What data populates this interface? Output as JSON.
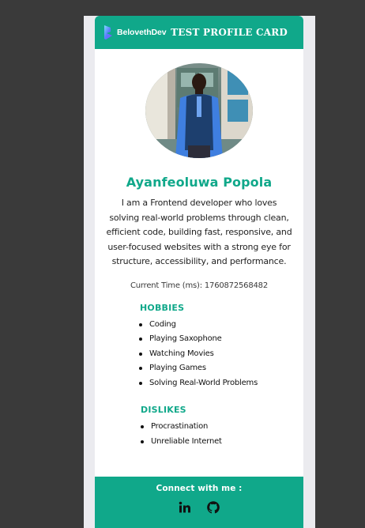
{
  "header": {
    "brand": "BelovethDev",
    "title": "TEST PROFILE CARD"
  },
  "profile": {
    "name": "Ayanfeoluwa Popola",
    "bio": "I am a Frontend developer who loves solving real-world problems through clean, efficient code, building fast, responsive, and user-focused websites with a strong eye for structure, accessibility, and performance.",
    "current_time": "Current Time (ms): 1760872568482"
  },
  "hobbies": {
    "title": "HOBBIES",
    "items": [
      "Coding",
      "Playing Saxophone",
      "Watching Movies",
      "Playing Games",
      "Solving Real-World Problems"
    ]
  },
  "dislikes": {
    "title": "DISLIKES",
    "items": [
      "Procrastination",
      "Unreliable Internet"
    ]
  },
  "footer": {
    "connect_label": "Connect with me :",
    "socials": [
      {
        "icon": "linkedin-icon"
      },
      {
        "icon": "github-icon"
      }
    ]
  },
  "colors": {
    "accent": "#10a88a",
    "background": "#3a3a3a",
    "card": "#ffffff"
  }
}
